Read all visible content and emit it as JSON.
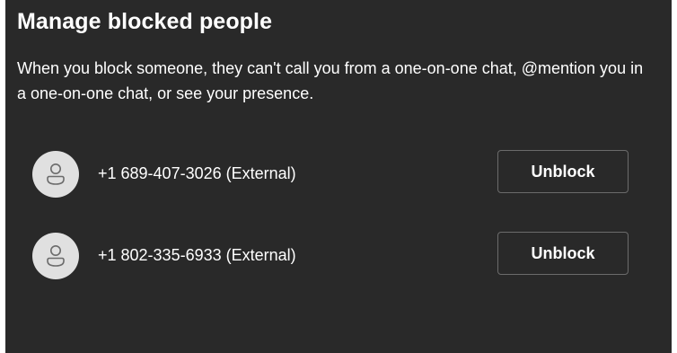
{
  "dialog": {
    "title": "Manage blocked people",
    "description": "When you block someone, they can't call you from a one-on-one chat, @mention you in a one-on-one chat, or see your presence.",
    "blocked": [
      {
        "number": "+1 689-407-3026 (External)",
        "action_label": "Unblock",
        "avatar_icon": "person-icon"
      },
      {
        "number": "+1 802-335-6933 (External)",
        "action_label": "Unblock",
        "avatar_icon": "person-icon"
      }
    ]
  },
  "colors": {
    "background": "#292929",
    "text": "#ffffff",
    "avatar_bg": "#e0e0e0",
    "avatar_icon": "#6b6b6b",
    "button_border": "#6b6b6b"
  }
}
